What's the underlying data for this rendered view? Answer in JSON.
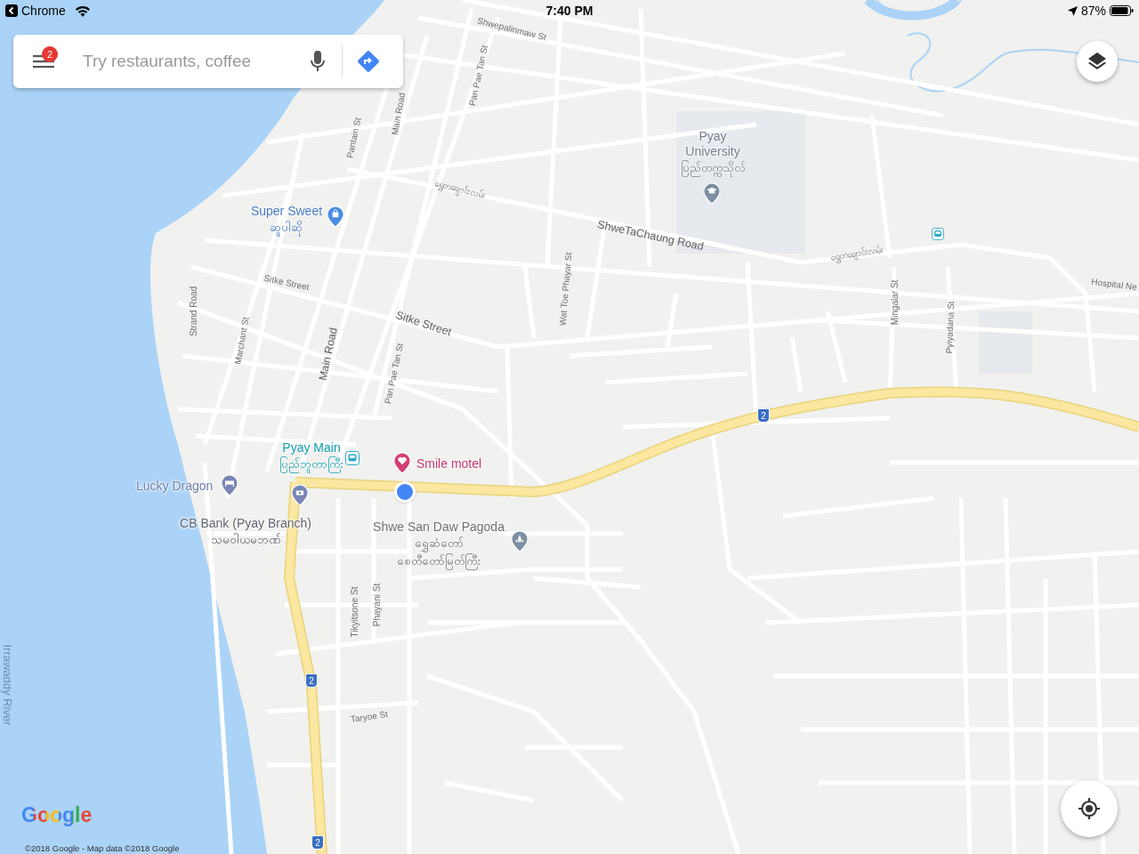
{
  "status_bar": {
    "back_app": "Chrome",
    "time": "7:40 PM",
    "battery": "87%"
  },
  "search": {
    "placeholder": "Try restaurants, coffee",
    "menu_badge": "2"
  },
  "map": {
    "labels": [
      {
        "kind": "street",
        "text": "Shwepalinmaw St"
      },
      {
        "kind": "street",
        "text": "Pan Pae Tan St"
      },
      {
        "kind": "street",
        "text": "Main Road"
      },
      {
        "kind": "street",
        "text": "Pantain St"
      },
      {
        "kind": "street",
        "text": "ရွှေတချောင်းလမ်း"
      },
      {
        "kind": "major",
        "text": "ShweTaChaung Road"
      },
      {
        "kind": "street",
        "text": "ရွှေတချောင်းလမ်း"
      },
      {
        "kind": "street",
        "text": "Sitke Street"
      },
      {
        "kind": "major",
        "text": "Sitke Street"
      },
      {
        "kind": "street",
        "text": "Strand Road"
      },
      {
        "kind": "street",
        "text": "Marchant St"
      },
      {
        "kind": "major",
        "text": "Main Road"
      },
      {
        "kind": "street",
        "text": "Pan Pae Tan St"
      },
      {
        "kind": "street",
        "text": "Wat Toe Phayar St"
      },
      {
        "kind": "street",
        "text": "Mingalar St"
      },
      {
        "kind": "street",
        "text": "Pyiyadana St"
      },
      {
        "kind": "street",
        "text": "Hospital Ne"
      },
      {
        "kind": "street",
        "text": "Tikyitsone St"
      },
      {
        "kind": "street",
        "text": "Phayani St"
      },
      {
        "kind": "street",
        "text": "Taryoe St"
      },
      {
        "kind": "river",
        "text": "Irrawaddy River"
      }
    ],
    "places": [
      {
        "kind": "university",
        "name": "Pyay University",
        "local_name": [
          "ပြည်တက္ကသိုလ်"
        ]
      },
      {
        "kind": "shop",
        "name": "Super Sweet",
        "local_name": [
          "ဆူပါဆို"
        ]
      },
      {
        "kind": "station",
        "name": "Pyay Main",
        "local_name": [
          "ပြည်ဘူတာကြီး"
        ]
      },
      {
        "kind": "motel",
        "name": "Smile motel"
      },
      {
        "kind": "hotel",
        "name": "Lucky Dragon"
      },
      {
        "kind": "bank",
        "name": "CB Bank (Pyay Branch)",
        "local_name": [
          "သမဝါယမဘဏ်"
        ]
      },
      {
        "kind": "pagoda",
        "name": "Shwe San Daw Pagoda",
        "local_name": [
          "ရွှေဆံတော်",
          "စေတီတော်မြတ်ကြီး"
        ]
      }
    ],
    "shields": [
      "2",
      "2",
      "2"
    ]
  },
  "logo": "Google",
  "attribution": "©2018 Google - Map data ©2018 Google"
}
